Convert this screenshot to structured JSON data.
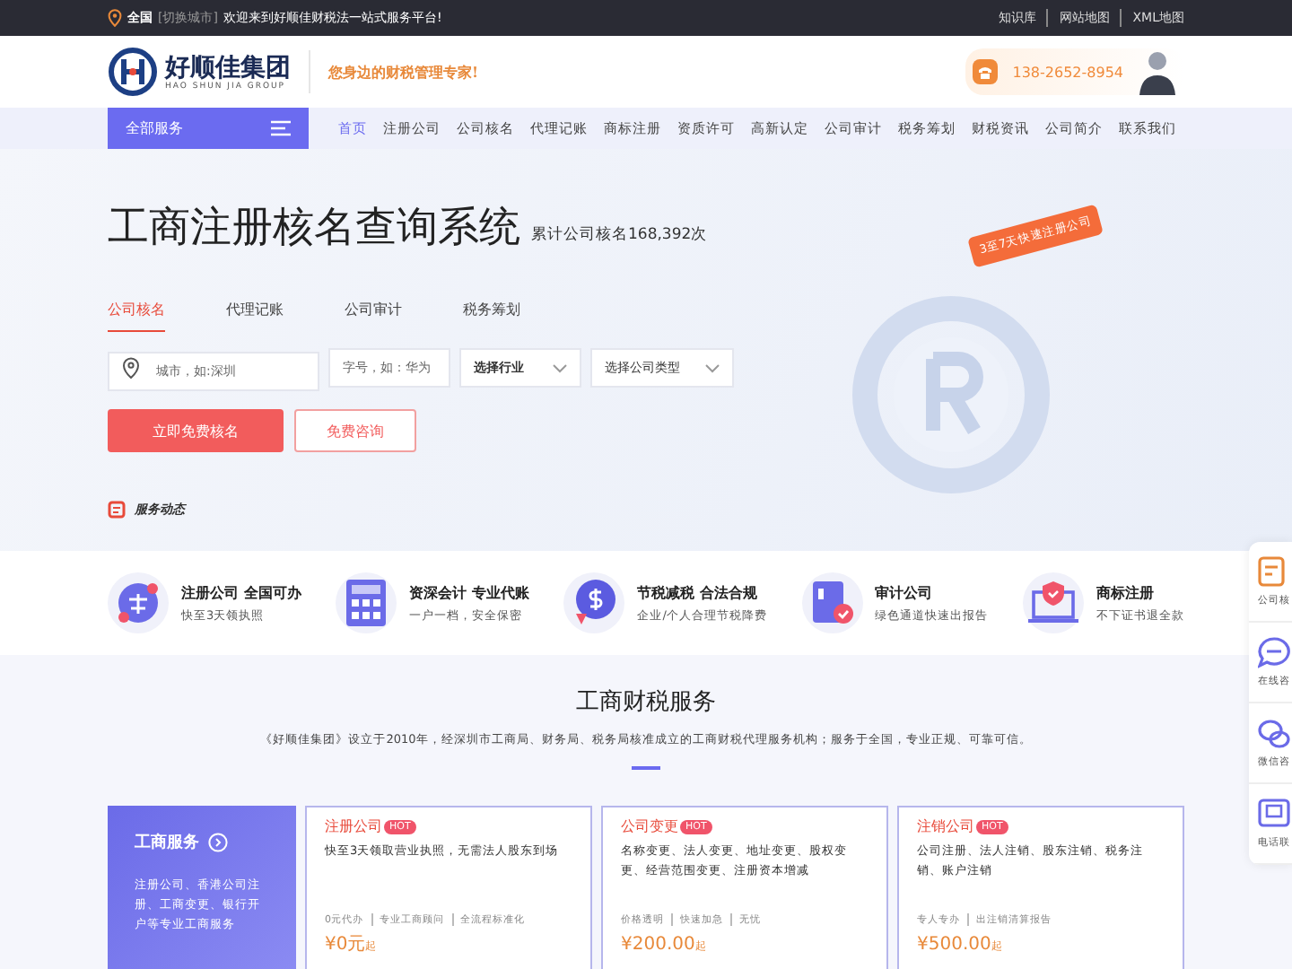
{
  "topbar": {
    "region": "全国",
    "switch": "[切换城市]",
    "welcome": "欢迎来到好顺佳财税法一站式服务平台!",
    "links": [
      "知识库",
      "网站地图",
      "XML地图"
    ]
  },
  "header": {
    "brand": "好顺佳集团",
    "brand_sub": "HAO SHUN JIA GROUP",
    "slogan": "您身边的财税管理专家!",
    "phone": "138-2652-8954"
  },
  "nav": {
    "all_services": "全部服务",
    "items": [
      {
        "label": "首页",
        "selected": true
      },
      {
        "label": "注册公司",
        "selected": false
      },
      {
        "label": "公司核名",
        "selected": false
      },
      {
        "label": "代理记账",
        "selected": false
      },
      {
        "label": "商标注册",
        "selected": false
      },
      {
        "label": "资质许可",
        "selected": false
      },
      {
        "label": "高新认定",
        "selected": false
      },
      {
        "label": "公司审计",
        "selected": false
      },
      {
        "label": "税务筹划",
        "selected": false
      },
      {
        "label": "财税资讯",
        "selected": false
      },
      {
        "label": "公司简介",
        "selected": false
      },
      {
        "label": "联系我们",
        "selected": false
      }
    ]
  },
  "hero": {
    "title": "工商注册核名查询系统",
    "counter": "累计公司核名168,392次",
    "badge": "3至7天快速注册公司",
    "tabs": [
      {
        "label": "公司核名",
        "selected": true
      },
      {
        "label": "代理记账",
        "selected": false
      },
      {
        "label": "公司审计",
        "selected": false
      },
      {
        "label": "税务筹划",
        "selected": false
      }
    ],
    "city_placeholder": "城市，如:深圳",
    "name_placeholder": "字号，如：华为",
    "industry": "选择行业",
    "company_type": "选择公司类型",
    "primary_button": "立即免费核名",
    "secondary_button": "免费咨询",
    "news_label": "服务动态"
  },
  "features": [
    {
      "title": "注册公司 全国可办",
      "desc": "快至3天领执照",
      "kind": "license"
    },
    {
      "title": "资深会计 专业代账",
      "desc": "一户一档，安全保密",
      "kind": "calculator"
    },
    {
      "title": "节税减税 合法合规",
      "desc": "企业/个人合理节税降费",
      "kind": "coin"
    },
    {
      "title": "审计公司",
      "desc": "绿色通道快速出报告",
      "kind": "report"
    },
    {
      "title": "商标注册",
      "desc": "不下证书退全款",
      "kind": "trademark"
    }
  ],
  "side_bar": [
    {
      "label": "公司核",
      "kind": "form"
    },
    {
      "label": "在线咨",
      "kind": "chat"
    },
    {
      "label": "微信咨",
      "kind": "wechat"
    },
    {
      "label": "电话联",
      "kind": "phone"
    }
  ],
  "services": {
    "title": "工商财税服务",
    "intro": "《好顺佳集团》设立于2010年，经深圳市工商局、财务局、税务局核准成立的工商财税代理服务机构；服务于全国，专业正规、可靠可信。",
    "category": {
      "title": "工商服务",
      "desc": "注册公司、香港公司注册、工商变更、银行开户等专业工商服务"
    },
    "cards": [
      {
        "title": "注册公司",
        "hot": "HOT",
        "desc": "快至3天领取营业执照，无需法人股东到场",
        "tags": [
          "0元代办",
          "专业工商顾问",
          "全流程标准化"
        ],
        "price": "¥0元",
        "unit": "起"
      },
      {
        "title": "公司变更",
        "hot": "HOT",
        "desc": "名称变更、法人变更、地址变更、股权变更、经营范围变更、注册资本增减",
        "tags": [
          "价格透明",
          "快速加急",
          "无忧"
        ],
        "price": "¥200.00",
        "unit": "起"
      },
      {
        "title": "注销公司",
        "hot": "HOT",
        "desc": "公司注册、法人注销、股东注销、税务注销、账户注销",
        "tags": [
          "专人专办",
          "出注销清算报告"
        ],
        "price": "¥500.00",
        "unit": "起"
      }
    ]
  }
}
